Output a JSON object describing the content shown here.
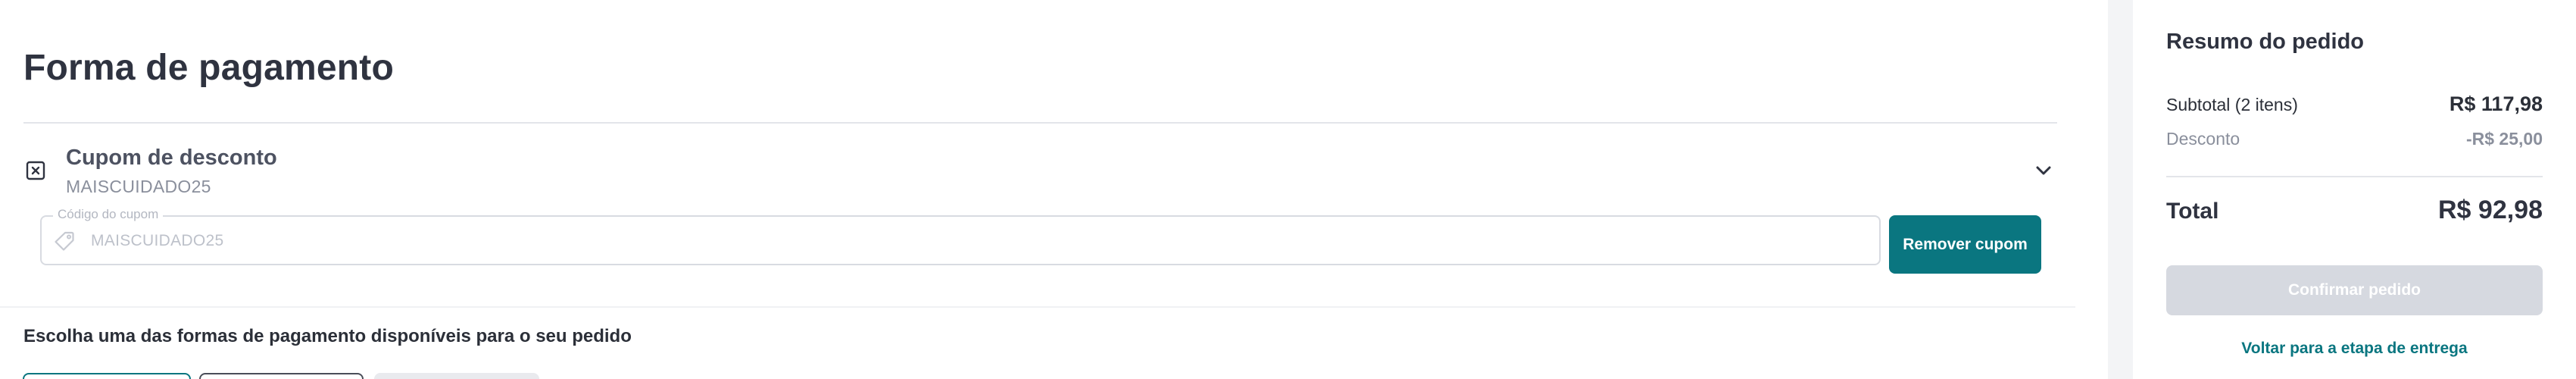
{
  "checkout": {
    "title": "Forma de pagamento",
    "coupon": {
      "title": "Cupom de desconto",
      "applied_code": "MAISCUIDADO25",
      "field_label": "Código do cupom",
      "field_value": "MAISCUIDADO25",
      "remove_button": "Remover cupom",
      "icons": {
        "coupon": "coupon-x-icon",
        "tag": "tag-icon",
        "toggle": "chevron-down-icon"
      }
    },
    "payment_instruction": "Escolha uma das formas de pagamento disponíveis para o seu pedido",
    "payment_method_count": 3
  },
  "summary": {
    "title": "Resumo do pedido",
    "subtotal_label": "Subtotal (2 itens)",
    "subtotal_value": "R$ 117,98",
    "discount_label": "Desconto",
    "discount_value": "-R$ 25,00",
    "total_label": "Total",
    "total_value": "R$ 92,98",
    "confirm_button": "Confirmar pedido",
    "back_link": "Voltar para a etapa de entrega"
  },
  "colors": {
    "accent": "#0a7680",
    "text_dark": "#2f3340",
    "text_muted": "#8a8f9c",
    "border": "#d8dbe1",
    "disabled_button": "#d6d9e0",
    "sidebar_band": "#f3f4f6"
  }
}
